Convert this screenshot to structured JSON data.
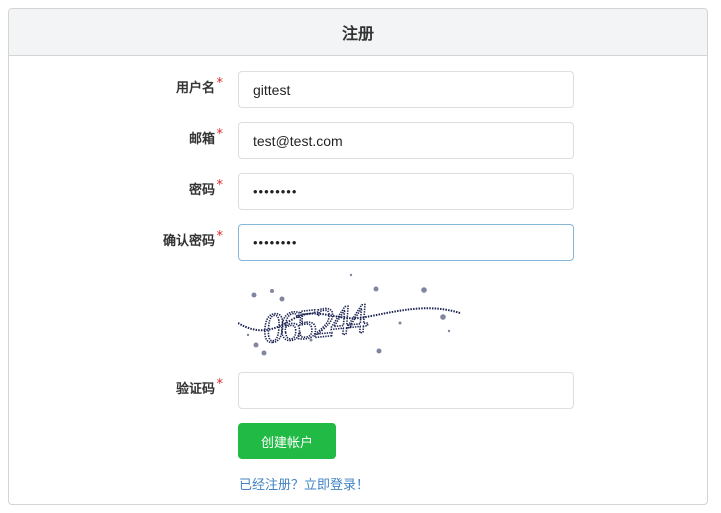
{
  "header": {
    "title": "注册"
  },
  "form": {
    "username": {
      "label": "用户名",
      "value": "gittest"
    },
    "email": {
      "label": "邮箱",
      "value": "test@test.com"
    },
    "password": {
      "label": "密码",
      "value": "testtest"
    },
    "confirm_password": {
      "label": "确认密码",
      "value": "testtest"
    },
    "captcha": {
      "label": "验证码",
      "value": "",
      "image_text": "065244"
    },
    "required_mark": "*",
    "submit_label": "创建帐户",
    "login_link": "已经注册？立即登录！"
  },
  "colors": {
    "submit": "#21ba45",
    "link": "#4183c4",
    "required": "#db2828",
    "captcha_ink": "#1b2352"
  }
}
